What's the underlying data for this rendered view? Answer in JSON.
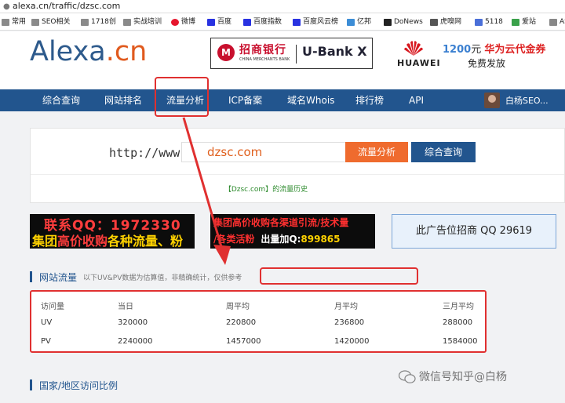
{
  "browser": {
    "url": "alexa.cn/traffic/dzsc.com",
    "bookmarks": [
      "常用",
      "SEO相关",
      "1718创",
      "实战培训",
      "微博",
      "百度",
      "百度指数",
      "百度风云榜",
      "亿邦",
      "DoNews",
      "虎嗅网",
      "5118",
      "爱站",
      "AS"
    ]
  },
  "header": {
    "logo_main": "Alexa",
    "logo_dot": ".",
    "logo_tld": "cn",
    "bank_name": "招商银行",
    "bank_en": "CHINA MERCHANTS BANK",
    "bank_product": "U-Bank X",
    "huawei_brand": "HUAWEI",
    "huawei_amount": "1200",
    "huawei_unit": "元",
    "huawei_promo": "华为云代金券",
    "huawei_sub": "免费发放"
  },
  "nav": {
    "items": [
      "综合查询",
      "网站排名",
      "流量分析",
      "ICP备案",
      "域名Whois",
      "排行榜",
      "API"
    ],
    "user": "白杨SEO..."
  },
  "search": {
    "prefix": "http://www.",
    "value": "dzsc.com",
    "btn_flow": "流量分析",
    "btn_query": "综合查询",
    "history": "【Dzsc.com】的流量历史"
  },
  "ads": {
    "qq_line1": "联系QQ：1972330",
    "qq_line2_a": "集团",
    "qq_line2_b": "高价收购",
    "qq_line2_c": "各种流量、粉",
    "group_line1": "集团高价收购各渠道引流/技术量",
    "group_line2_a": "/各类活粉",
    "group_line2_b": "出量加Q:",
    "group_line2_c": "899865",
    "slot": "此广告位招商  QQ 29619"
  },
  "traffic": {
    "title": "网站流量",
    "note": "以下UV&PV数据为估算值，非精确统计，仅供参考",
    "headers": [
      "访问量",
      "当日",
      "周平均",
      "月平均",
      "三月平均"
    ],
    "rows": [
      [
        "UV",
        "320000",
        "220800",
        "236800",
        "288000"
      ],
      [
        "PV",
        "2240000",
        "1457000",
        "1420000",
        "1584000"
      ]
    ]
  },
  "region": {
    "title": "国家/地区访问比例"
  },
  "watermark": "微信号知乎@白杨",
  "colors": {
    "nav": "#22558e",
    "accent": "#ef6b2e",
    "annotation": "#e03030"
  }
}
